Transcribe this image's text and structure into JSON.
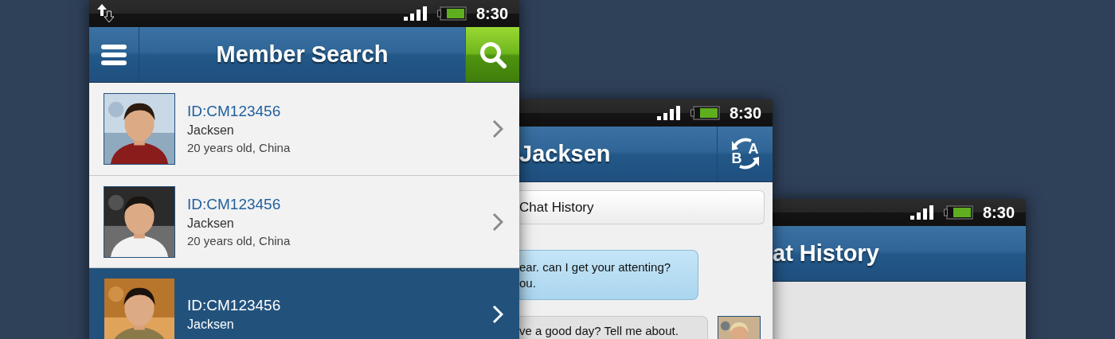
{
  "phones": [
    {
      "kind": "search",
      "status_bar": {
        "time": "8:30",
        "data_icon": true
      },
      "header": {
        "title": "Member Search"
      },
      "members": [
        {
          "id": "ID:CM123456",
          "name": "Jacksen",
          "detail": "20 years old, China",
          "selected": false
        },
        {
          "id": "ID:CM123456",
          "name": "Jacksen",
          "detail": "20 years old, China",
          "selected": false
        },
        {
          "id": "ID:CM123456",
          "name": "Jacksen",
          "selected": true
        }
      ]
    },
    {
      "kind": "chat",
      "status_bar": {
        "time": "8:30",
        "data_icon": false
      },
      "header": {
        "title": "Jacksen",
        "translate_letters": [
          "B",
          "A"
        ]
      },
      "history_button": "Chat History",
      "messages": [
        {
          "kind": "incoming",
          "text": "ear. can I get your attenting?\nou."
        },
        {
          "kind": "outgoing",
          "text": "ve a good day? Tell me about."
        }
      ]
    },
    {
      "kind": "history",
      "status_bar": {
        "time": "8:30",
        "data_icon": false
      },
      "header": {
        "title": "at History"
      }
    }
  ]
}
